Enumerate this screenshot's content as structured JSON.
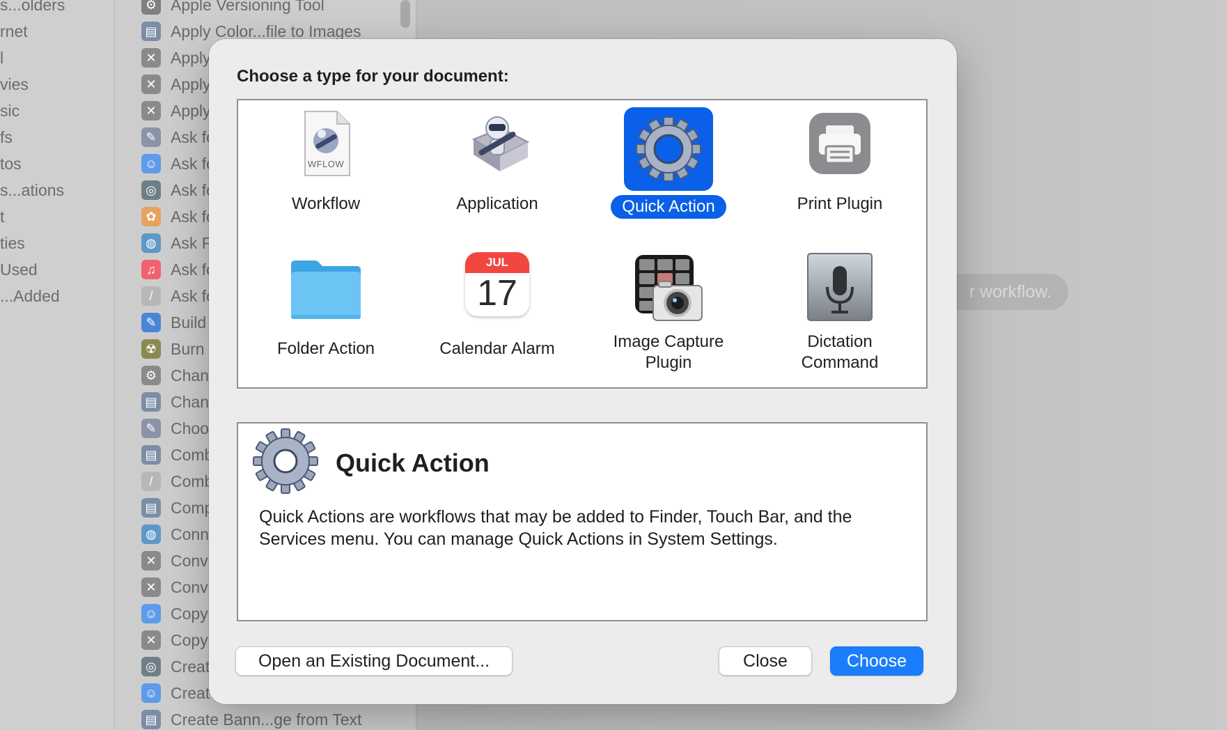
{
  "background": {
    "library_items": [
      "s...olders",
      "rnet",
      "l",
      "vies",
      "sic",
      "fs",
      "tos",
      "s...ations",
      "t",
      "ties",
      "Used",
      "...Added"
    ],
    "actions": [
      {
        "label": "Apple Versioning Tool",
        "icon": "tool-icon",
        "color": "#7f7f7f"
      },
      {
        "label": "Apply Color...file to Images",
        "icon": "preview-icon",
        "color": "#7c8ea6"
      },
      {
        "label": "Apply",
        "icon": "x-tools-icon",
        "color": "#8a8a8a"
      },
      {
        "label": "Apply",
        "icon": "x-tools-icon",
        "color": "#8a8a8a"
      },
      {
        "label": "Apply",
        "icon": "x-tools-icon",
        "color": "#8a8a8a"
      },
      {
        "label": "Ask fo",
        "icon": "automator-icon",
        "color": "#8a93a8"
      },
      {
        "label": "Ask fo",
        "icon": "finder-icon",
        "color": "#5e9be8"
      },
      {
        "label": "Ask fo",
        "icon": "spotlight-icon",
        "color": "#6f7f88"
      },
      {
        "label": "Ask fo",
        "icon": "photos-icon",
        "color": "#e7a35e"
      },
      {
        "label": "Ask F",
        "icon": "globe-icon",
        "color": "#5e98c8"
      },
      {
        "label": "Ask fo",
        "icon": "music-icon",
        "color": "#f0626e"
      },
      {
        "label": "Ask fo",
        "icon": "text-icon",
        "color": "#b7b7b7"
      },
      {
        "label": "Build",
        "icon": "build-icon",
        "color": "#4a86d8"
      },
      {
        "label": "Burn",
        "icon": "burn-icon",
        "color": "#8a8a50"
      },
      {
        "label": "Chan",
        "icon": "system-icon",
        "color": "#8a8a8a"
      },
      {
        "label": "Chan",
        "icon": "preview-icon",
        "color": "#7c8ea6"
      },
      {
        "label": "Choo",
        "icon": "automator-icon",
        "color": "#8a93a8"
      },
      {
        "label": "Comb",
        "icon": "preview-icon",
        "color": "#7c8ea6"
      },
      {
        "label": "Comb",
        "icon": "text-icon",
        "color": "#b7b7b7"
      },
      {
        "label": "Comp",
        "icon": "preview-icon",
        "color": "#7c8ea6"
      },
      {
        "label": "Conn",
        "icon": "globe-icon",
        "color": "#5e98c8"
      },
      {
        "label": "Conv",
        "icon": "x-tools-icon",
        "color": "#8a8a8a"
      },
      {
        "label": "Conv",
        "icon": "x-tools-icon",
        "color": "#8a8a8a"
      },
      {
        "label": "Copy",
        "icon": "finder-icon",
        "color": "#5e9be8"
      },
      {
        "label": "Copy",
        "icon": "x-tools-icon",
        "color": "#8a8a8a"
      },
      {
        "label": "Creat",
        "icon": "spotlight-icon",
        "color": "#6f7f88"
      },
      {
        "label": "Creat",
        "icon": "finder-icon",
        "color": "#5e9be8"
      },
      {
        "label": "Create Bann...ge from Text",
        "icon": "preview-icon",
        "color": "#7c8ea6"
      }
    ],
    "hint": "r workflow."
  },
  "dialog": {
    "title": "Choose a type for your document:",
    "selected_type": "Quick Action",
    "types": [
      {
        "label": "Workflow",
        "icon": "workflow-file-icon",
        "badge": "WFLOW"
      },
      {
        "label": "Application",
        "icon": "automator-robot-icon"
      },
      {
        "label": "Quick Action",
        "icon": "gear-icon"
      },
      {
        "label": "Print Plugin",
        "icon": "printer-icon"
      },
      {
        "label": "Folder Action",
        "icon": "folder-icon"
      },
      {
        "label": "Calendar Alarm",
        "icon": "calendar-icon",
        "month": "JUL",
        "day": "17"
      },
      {
        "label": "Image Capture\nPlugin",
        "icon": "image-capture-icon"
      },
      {
        "label": "Dictation\nCommand",
        "icon": "microphone-icon"
      }
    ],
    "description": {
      "title": "Quick Action",
      "text": "Quick Actions are workflows that may be added to Finder, Touch Bar, and the Services menu. You can manage Quick Actions in System Settings."
    },
    "buttons": {
      "open_existing": "Open an Existing Document...",
      "close": "Close",
      "choose": "Choose"
    },
    "colors": {
      "accent": "#0a60e8",
      "primary_button": "#1a7dfb"
    }
  }
}
